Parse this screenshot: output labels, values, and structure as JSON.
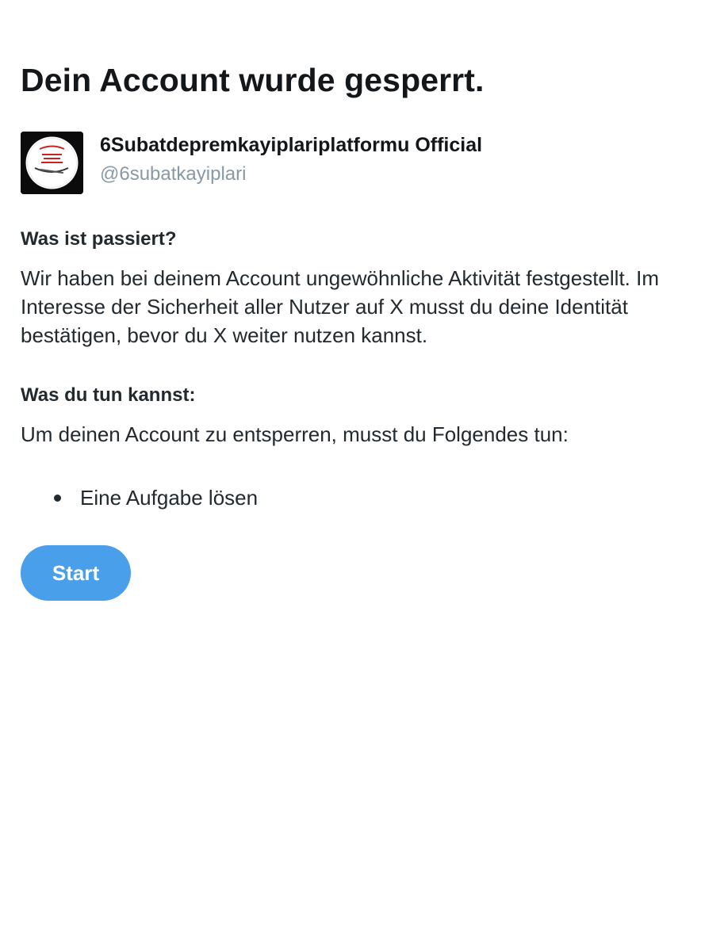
{
  "page": {
    "title": "Dein Account wurde gesperrt."
  },
  "account": {
    "display_name": "6Subatdepremkayiplariplatformu Official",
    "handle": "@6subatkayiplari",
    "avatar_icon": "circular-logo-avatar"
  },
  "what_happened": {
    "heading": "Was ist passiert?",
    "text": "Wir haben bei deinem Account ungewöhnliche Aktivität festgestellt. Im Interesse der Sicherheit aller Nutzer auf X musst du deine Identität bestätigen, bevor du X weiter nutzen kannst."
  },
  "what_to_do": {
    "heading": "Was du tun kannst:",
    "text": "Um deinen Account zu entsperren, musst du Folgendes tun:",
    "tasks": [
      "Eine Aufgabe lösen"
    ]
  },
  "actions": {
    "start_label": "Start"
  },
  "colors": {
    "accent": "#4a9fea",
    "text": "#14171a",
    "handle": "#8899a6",
    "background": "#ffffff"
  }
}
